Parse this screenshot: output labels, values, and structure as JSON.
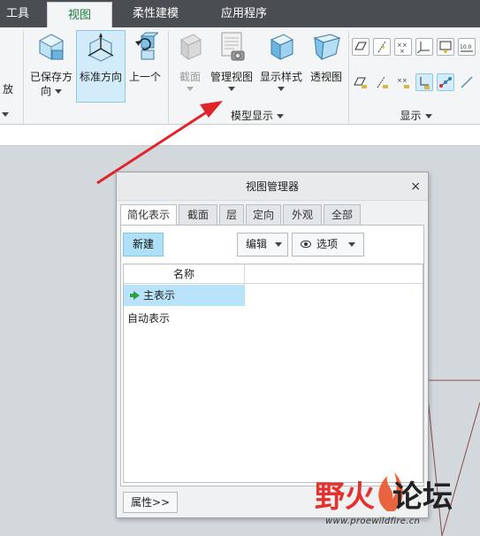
{
  "colors": {
    "tabbar_bg": "#4a4e52",
    "active_tab_text": "#1b7a3a",
    "highlight": "#d2ecfa",
    "arrow": "#e0242b"
  },
  "tabs": [
    {
      "label": "工具",
      "active": false
    },
    {
      "label": "视图",
      "active": true
    },
    {
      "label": "柔性建模",
      "active": false
    },
    {
      "label": "应用程序",
      "active": false
    }
  ],
  "ribbon": {
    "left_cut_label": "放",
    "orientation": {
      "saved": "已保存方",
      "saved_line2": "向",
      "standard": "标准方向",
      "previous": "上一个"
    },
    "model_display": {
      "section": "截面",
      "manage_views": "管理视图",
      "display_style": "显示样式",
      "perspective": "透视图",
      "group_label": "模型显示"
    },
    "show": {
      "group_label": "显示",
      "icons": [
        "datum-plane-icon",
        "datum-axis-icon",
        "datum-point-icon",
        "coord-sys-icon",
        "annotation-icon",
        "datum-plane-tag-icon",
        "axis-tag-icon",
        "point-tag-icon",
        "csys-tag-icon",
        "spin-center-icon"
      ]
    }
  },
  "dialog": {
    "title": "视图管理器",
    "close": "×",
    "tabs": [
      "简化表示",
      "截面",
      "层",
      "定向",
      "外观",
      "全部"
    ],
    "new_button": "新建",
    "edit_dropdown": "编辑",
    "options_dropdown": "选项",
    "column_header": "名称",
    "rows": [
      {
        "label": "主表示",
        "selected": true
      },
      {
        "label": "自动表示",
        "selected": false
      }
    ],
    "properties_button": "属性>>"
  },
  "watermark": {
    "text_a": "野火",
    "text_b": "论坛",
    "url": "www.proewildfire.cn"
  }
}
